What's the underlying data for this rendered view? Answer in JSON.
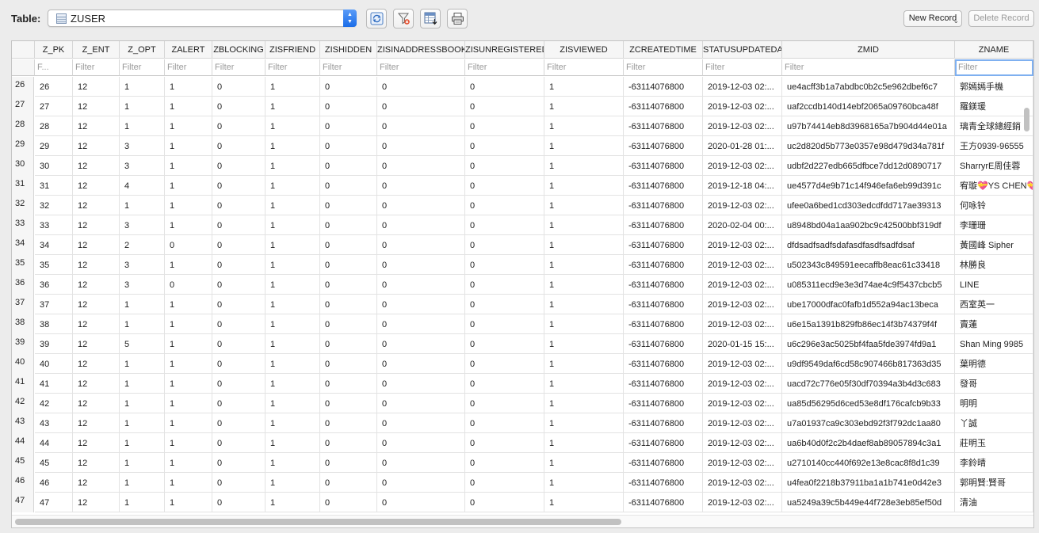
{
  "toolbar": {
    "table_label": "Table:",
    "table_value": "ZUSER",
    "new_record": "New Record",
    "delete_record": "Delete Record"
  },
  "columns": [
    "Z_PK",
    "Z_ENT",
    "Z_OPT",
    "ZALERT",
    "ZBLOCKING",
    "ZISFRIEND",
    "ZISHIDDEN",
    "ZISINADDRESSBOOK",
    "ZISUNREGISTERED",
    "ZISVIEWED",
    "ZCREATEDTIME",
    "STATUSUPDATEDA",
    "ZMID",
    "ZNAME"
  ],
  "filters": [
    "F...",
    "Filter",
    "Filter",
    "Filter",
    "Filter",
    "Filter",
    "Filter",
    "Filter",
    "Filter",
    "Filter",
    "Filter",
    "Filter",
    "Filter",
    "Filter"
  ],
  "rows": [
    [
      "26",
      "26",
      "12",
      "1",
      "1",
      "0",
      "1",
      "0",
      "0",
      "0",
      "1",
      "-63114076800",
      "2019-12-03 02:...",
      "ue4acff3b1a7abdbc0b2c5e962dbef6c7",
      "郭嫣嫣手機"
    ],
    [
      "27",
      "27",
      "12",
      "1",
      "1",
      "0",
      "1",
      "0",
      "0",
      "0",
      "1",
      "-63114076800",
      "2019-12-03 02:...",
      "uaf2ccdb140d14ebf2065a09760bca48f",
      "羅鎂瑗"
    ],
    [
      "28",
      "28",
      "12",
      "1",
      "1",
      "0",
      "1",
      "0",
      "0",
      "0",
      "1",
      "-63114076800",
      "2019-12-03 02:...",
      "u97b74414eb8d3968165a7b904d44e01a",
      "璃青全球總經銷"
    ],
    [
      "29",
      "29",
      "12",
      "3",
      "1",
      "0",
      "1",
      "0",
      "0",
      "0",
      "1",
      "-63114076800",
      "2020-01-28 01:...",
      "uc2d820d5b773e0357e98d479d34a781f",
      "王方0939-96555"
    ],
    [
      "30",
      "30",
      "12",
      "3",
      "1",
      "0",
      "1",
      "0",
      "0",
      "0",
      "1",
      "-63114076800",
      "2019-12-03 02:...",
      "udbf2d227edb665dfbce7dd12d0890717",
      "SharryrE周佳蓉"
    ],
    [
      "31",
      "31",
      "12",
      "4",
      "1",
      "0",
      "1",
      "0",
      "0",
      "0",
      "1",
      "-63114076800",
      "2019-12-18 04:...",
      "ue4577d4e9b71c14f946efa6eb99d391c",
      "宥璇💝YS CHEN💝"
    ],
    [
      "32",
      "32",
      "12",
      "1",
      "1",
      "0",
      "1",
      "0",
      "0",
      "0",
      "1",
      "-63114076800",
      "2019-12-03 02:...",
      "ufee0a6bed1cd303edcdfdd717ae39313",
      "何咏铃"
    ],
    [
      "33",
      "33",
      "12",
      "3",
      "1",
      "0",
      "1",
      "0",
      "0",
      "0",
      "1",
      "-63114076800",
      "2020-02-04 00:...",
      "u8948bd04a1aa902bc9c42500bbf319df",
      "李珊珊"
    ],
    [
      "34",
      "34",
      "12",
      "2",
      "0",
      "0",
      "1",
      "0",
      "0",
      "0",
      "1",
      "-63114076800",
      "2019-12-03 02:...",
      "dfdsadfsadfsdafasdfasdfsadfdsaf",
      "黃國峰 Sipher"
    ],
    [
      "35",
      "35",
      "12",
      "3",
      "1",
      "0",
      "1",
      "0",
      "0",
      "0",
      "1",
      "-63114076800",
      "2019-12-03 02:...",
      "u502343c849591eecaffb8eac61c33418",
      "林勝良"
    ],
    [
      "36",
      "36",
      "12",
      "3",
      "0",
      "0",
      "1",
      "0",
      "0",
      "0",
      "1",
      "-63114076800",
      "2019-12-03 02:...",
      "u085311ecd9e3e3d74ae4c9f5437cbcb5",
      "LINE"
    ],
    [
      "37",
      "37",
      "12",
      "1",
      "1",
      "0",
      "1",
      "0",
      "0",
      "0",
      "1",
      "-63114076800",
      "2019-12-03 02:...",
      "ube17000dfac0fafb1d552a94ac13beca",
      "西室英一"
    ],
    [
      "38",
      "38",
      "12",
      "1",
      "1",
      "0",
      "1",
      "0",
      "0",
      "0",
      "1",
      "-63114076800",
      "2019-12-03 02:...",
      "u6e15a1391b829fb86ec14f3b74379f4f",
      "賣蓮"
    ],
    [
      "39",
      "39",
      "12",
      "5",
      "1",
      "0",
      "1",
      "0",
      "0",
      "0",
      "1",
      "-63114076800",
      "2020-01-15 15:...",
      "u6c296e3ac5025bf4faa5fde3974fd9a1",
      "Shan Ming 9985"
    ],
    [
      "40",
      "40",
      "12",
      "1",
      "1",
      "0",
      "1",
      "0",
      "0",
      "0",
      "1",
      "-63114076800",
      "2019-12-03 02:...",
      "u9df9549daf6cd58c907466b817363d35",
      "葉明德"
    ],
    [
      "41",
      "41",
      "12",
      "1",
      "1",
      "0",
      "1",
      "0",
      "0",
      "0",
      "1",
      "-63114076800",
      "2019-12-03 02:...",
      "uacd72c776e05f30df70394a3b4d3c683",
      "發哥"
    ],
    [
      "42",
      "42",
      "12",
      "1",
      "1",
      "0",
      "1",
      "0",
      "0",
      "0",
      "1",
      "-63114076800",
      "2019-12-03 02:...",
      "ua85d56295d6ced53e8df176cafcb9b33",
      "明明"
    ],
    [
      "43",
      "43",
      "12",
      "1",
      "1",
      "0",
      "1",
      "0",
      "0",
      "0",
      "1",
      "-63114076800",
      "2019-12-03 02:...",
      "u7a01937ca9c303ebd92f3f792dc1aa80",
      "丫誠"
    ],
    [
      "44",
      "44",
      "12",
      "1",
      "1",
      "0",
      "1",
      "0",
      "0",
      "0",
      "1",
      "-63114076800",
      "2019-12-03 02:...",
      "ua6b40d0f2c2b4daef8ab89057894c3a1",
      "莊明玉"
    ],
    [
      "45",
      "45",
      "12",
      "1",
      "1",
      "0",
      "1",
      "0",
      "0",
      "0",
      "1",
      "-63114076800",
      "2019-12-03 02:...",
      "u2710140cc440f692e13e8cac8f8d1c39",
      "李鈴晴"
    ],
    [
      "46",
      "46",
      "12",
      "1",
      "1",
      "0",
      "1",
      "0",
      "0",
      "0",
      "1",
      "-63114076800",
      "2019-12-03 02:...",
      "u4fea0f2218b37911ba1a1b741e0d42e3",
      "郭明賢:賢哥"
    ],
    [
      "47",
      "47",
      "12",
      "1",
      "1",
      "0",
      "1",
      "0",
      "0",
      "0",
      "1",
      "-63114076800",
      "2019-12-03 02:...",
      "ua5249a39c5b449e44f728e3eb85ef50d",
      "清油"
    ]
  ]
}
